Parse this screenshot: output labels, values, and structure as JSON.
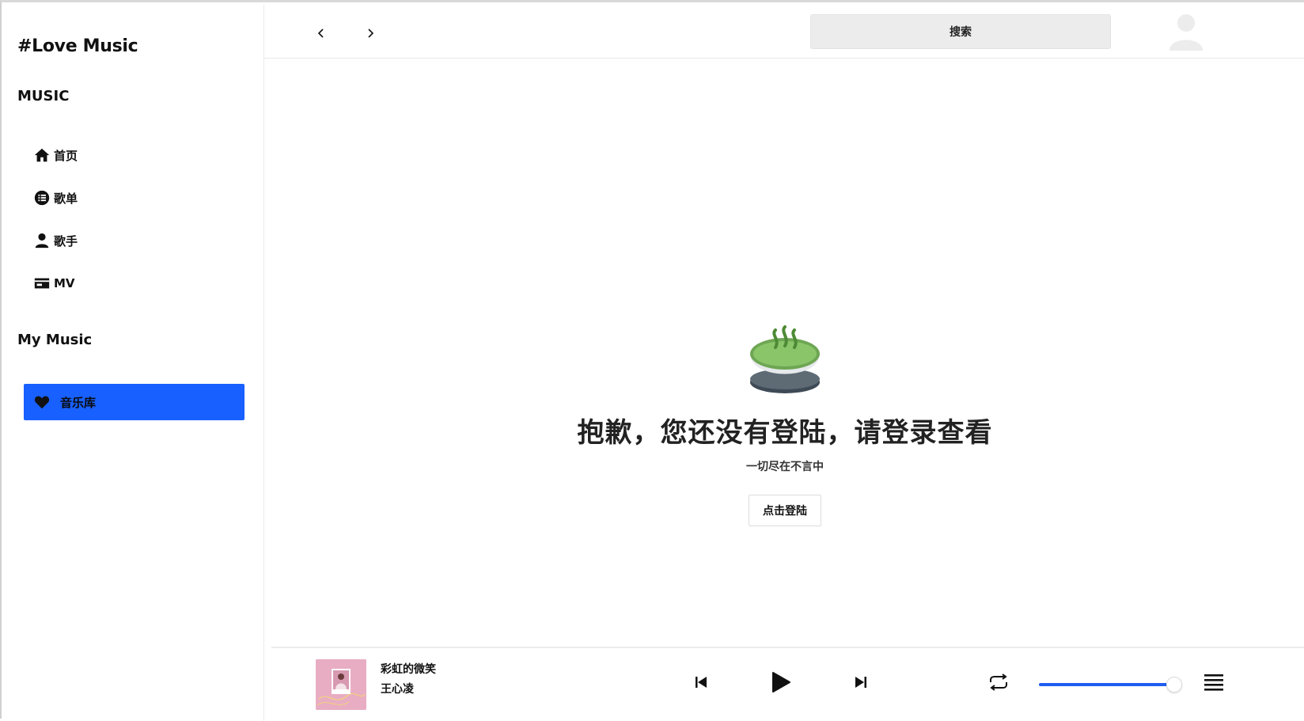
{
  "brand": "#Love Music",
  "colors": {
    "accent": "#1860ff",
    "volume": "#1f5cf0",
    "cover_bg": "#e8adc3",
    "tea_green": "#8bc56a"
  },
  "sidebar": {
    "music_section": "MUSIC",
    "items": [
      {
        "label": "首页",
        "icon": "home-icon"
      },
      {
        "label": "歌单",
        "icon": "list-icon"
      },
      {
        "label": "歌手",
        "icon": "user-icon"
      },
      {
        "label": "MV",
        "icon": "video-card-icon"
      }
    ],
    "my_section": "My Music",
    "library": {
      "label": "音乐库",
      "icon": "heart-icon"
    }
  },
  "topbar": {
    "back_icon": "chevron-left-icon",
    "forward_icon": "chevron-right-icon",
    "search_label": "搜索",
    "avatar_icon": "user-avatar-icon"
  },
  "empty_state": {
    "icon": "tea-cup-icon",
    "title": "抱歉，您还没有登陆，请登录查看",
    "subtitle": "一切尽在不言中",
    "login_button": "点击登陆"
  },
  "player": {
    "song_title": "彩虹的微笑",
    "artist": "王心凌",
    "volume_fraction": 0.95,
    "controls": [
      "previous-icon",
      "play-icon",
      "next-icon",
      "repeat-icon",
      "playlist-icon"
    ]
  }
}
